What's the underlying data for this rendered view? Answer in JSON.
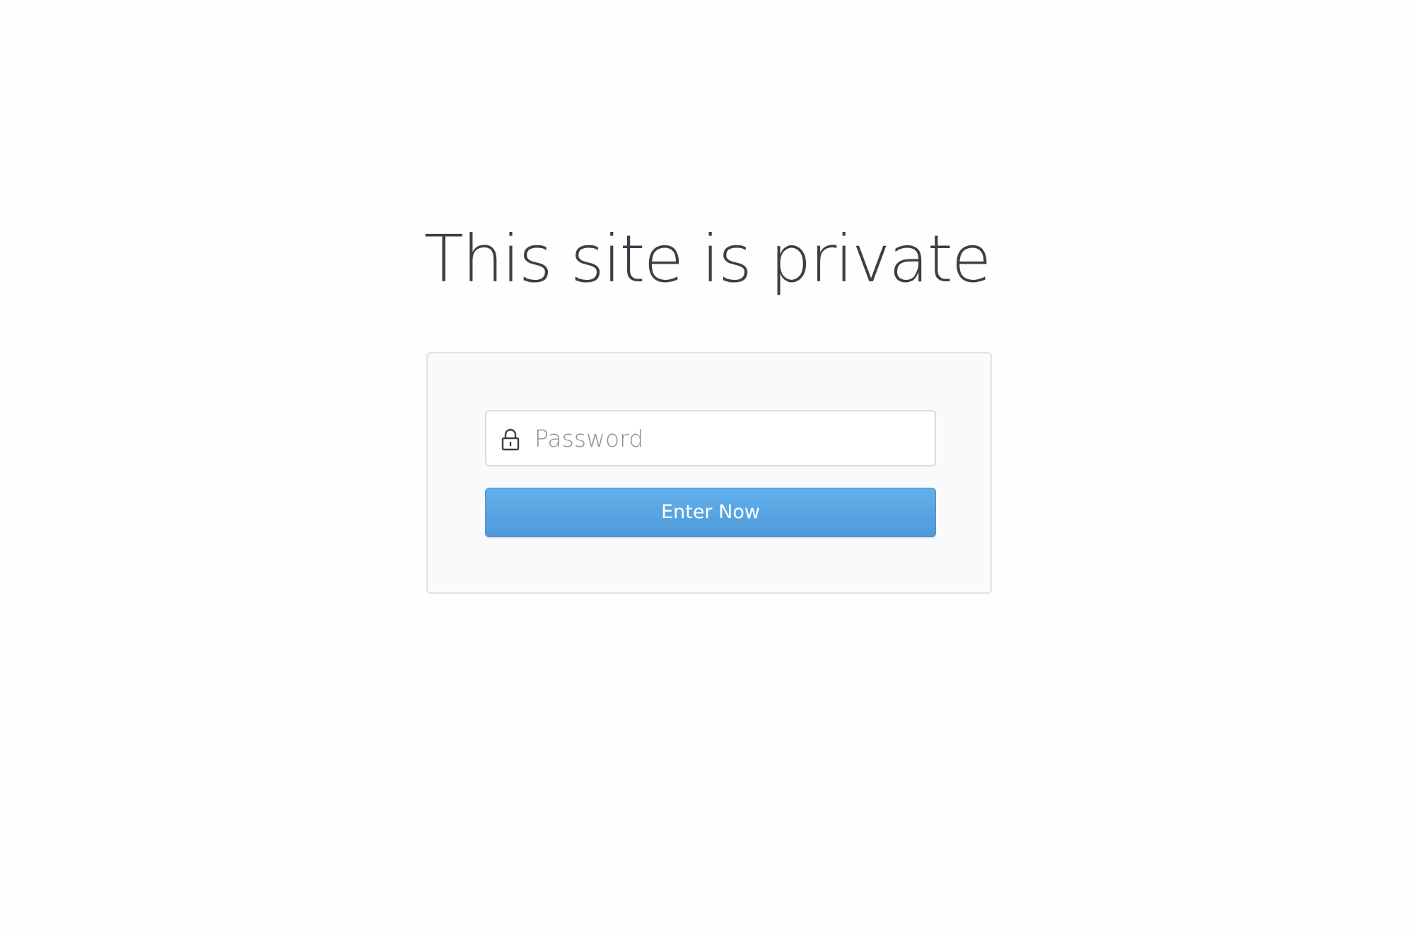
{
  "page": {
    "title": "This site is private"
  },
  "form": {
    "password_placeholder": "Password",
    "password_value": "",
    "lock_icon": "lock-icon",
    "submit_label": "Enter Now"
  },
  "colors": {
    "title_text": "#3b4047",
    "card_background": "#f9fafb",
    "button_accent": "#4f9ad9",
    "button_text": "#ffffff"
  }
}
